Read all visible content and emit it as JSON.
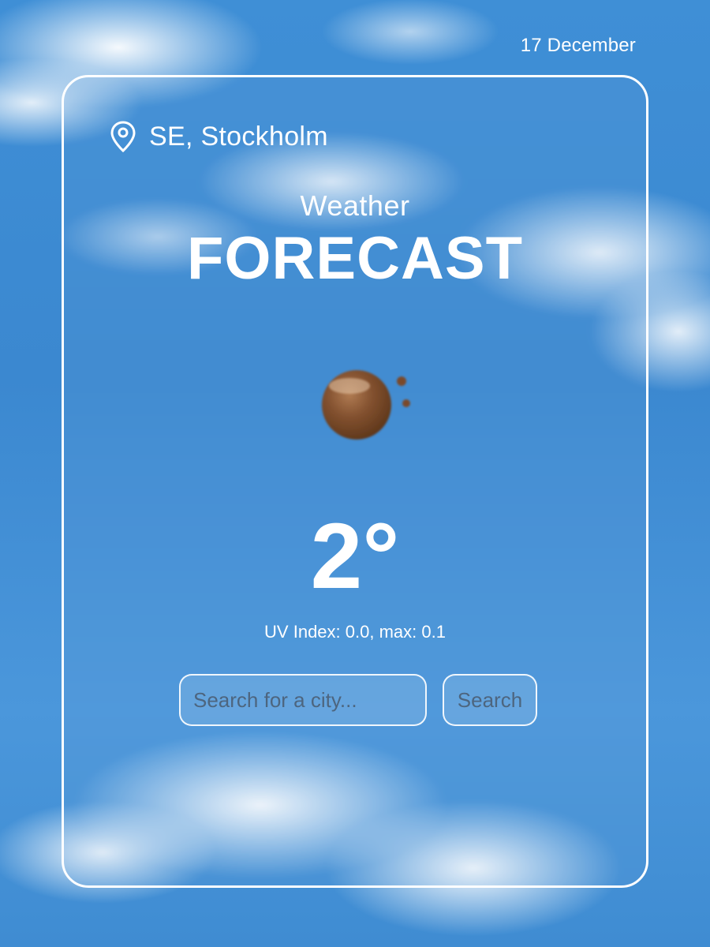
{
  "header": {
    "date": "17 December"
  },
  "card": {
    "location": {
      "icon": "location-pin-icon",
      "city": "SE, Stockholm"
    },
    "heading": {
      "sub": "Weather",
      "main": "FORECAST"
    },
    "weather": {
      "icon": "night-moon-icon",
      "temperature": "2°",
      "uv_text": "UV Index: 0.0, max: 0.1"
    },
    "search": {
      "placeholder": "Search for a city...",
      "value": "",
      "button_label": "Search"
    }
  },
  "colors": {
    "text": "#ffffff",
    "sky": "#3f8fd6",
    "moon": "#7a4a2a"
  }
}
